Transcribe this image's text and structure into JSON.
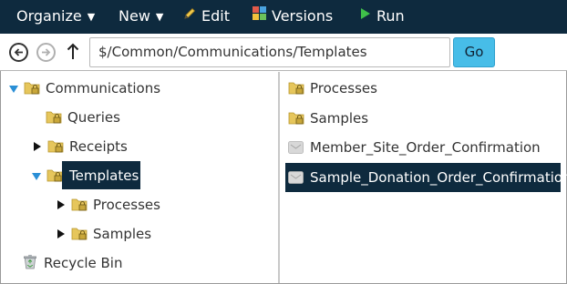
{
  "toolbar": {
    "organize_label": "Organize",
    "new_label": "New",
    "edit_label": "Edit",
    "versions_label": "Versions",
    "run_label": "Run"
  },
  "address": {
    "path": "$/Common/Communications/Templates",
    "go_label": "Go"
  },
  "tree": {
    "communications": "Communications",
    "queries": "Queries",
    "receipts": "Receipts",
    "templates": "Templates",
    "processes": "Processes",
    "samples": "Samples",
    "recycle_bin": "Recycle Bin"
  },
  "list": {
    "items": [
      {
        "label": "Processes",
        "type": "folder"
      },
      {
        "label": "Samples",
        "type": "folder"
      },
      {
        "label": "Member_Site_Order_Confirmation",
        "type": "template"
      },
      {
        "label": "Sample_Donation_Order_Confirmation",
        "type": "template",
        "selected": true
      }
    ]
  },
  "colors": {
    "toolbar_bg": "#0e2a3e",
    "selection_bg": "#0e2a3e",
    "go_button": "#47bde8",
    "folder_yellow": "#e6c65c"
  }
}
